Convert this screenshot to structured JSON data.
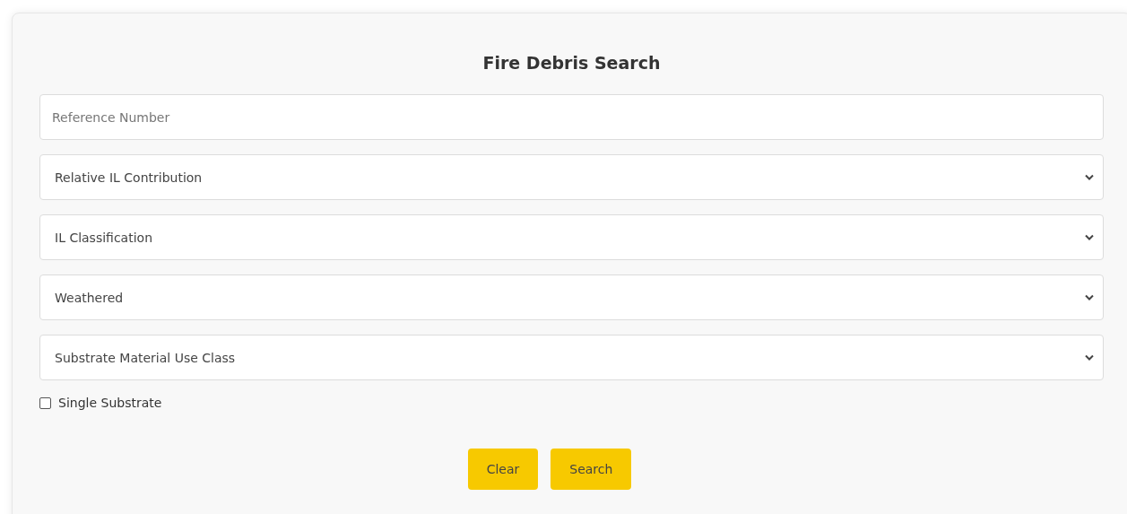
{
  "title": "Fire Debris Search",
  "fields": [
    {
      "kind": "text",
      "placeholder": "Reference Number"
    },
    {
      "kind": "select",
      "value": "Relative IL Contribution"
    },
    {
      "kind": "select",
      "value": "IL Classification"
    },
    {
      "kind": "select",
      "value": "Weathered"
    },
    {
      "kind": "select",
      "value": "Substrate Material Use Class"
    }
  ],
  "checkbox": {
    "label": "Single Substrate",
    "checked": false
  },
  "buttons": [
    "Clear",
    "Search"
  ]
}
